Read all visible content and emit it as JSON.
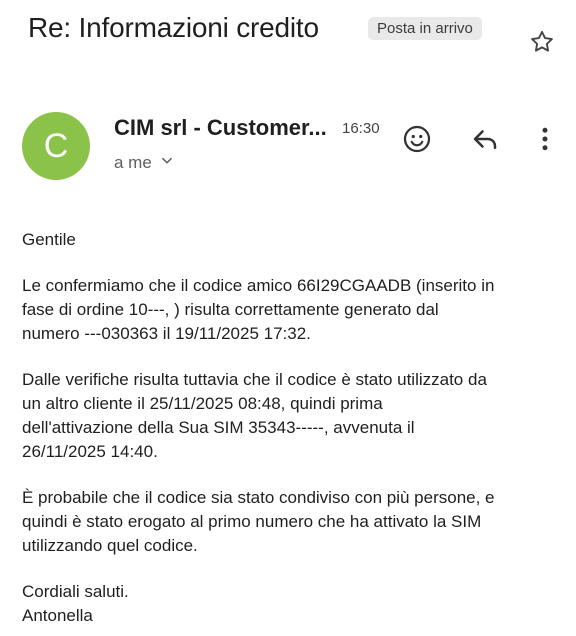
{
  "email": {
    "subject": "Re: Informazioni credito",
    "label": "Posta in arrivo",
    "sender": {
      "name": "CIM srl - Customer...",
      "initial": "C",
      "avatar_color": "#8bc34a",
      "time": "16:30",
      "recipient": "a me"
    },
    "icons": {
      "star": "star-icon",
      "emoji": "emoji-reaction-icon",
      "reply": "reply-icon",
      "more": "more-vert-icon",
      "expand": "chevron-down-icon"
    },
    "body": {
      "greeting": "Gentile",
      "paragraph1": "Le confermiamo che il codice amico 66I29CGAADB (inserito in\nfase di ordine 10‑‑‑, ) risulta correttamente generato dal\nnumero ‑‑‑030363 il 19/11/2025 17:32.",
      "paragraph2": "Dalle verifiche risulta tuttavia che il codice è stato utilizzato da\nun altro cliente il 25/11/2025 08:48, quindi prima\ndell'attivazione della Sua SIM 35343‑‑‑‑‑, avvenuta il\n26/11/2025 14:40.",
      "paragraph3": "È probabile che il codice sia stato condiviso con più persone, e\nquindi è stato erogato al primo numero che ha attivato la SIM\nutilizzando quel codice.",
      "closing": "Cordiali saluti.\nAntonella"
    }
  }
}
